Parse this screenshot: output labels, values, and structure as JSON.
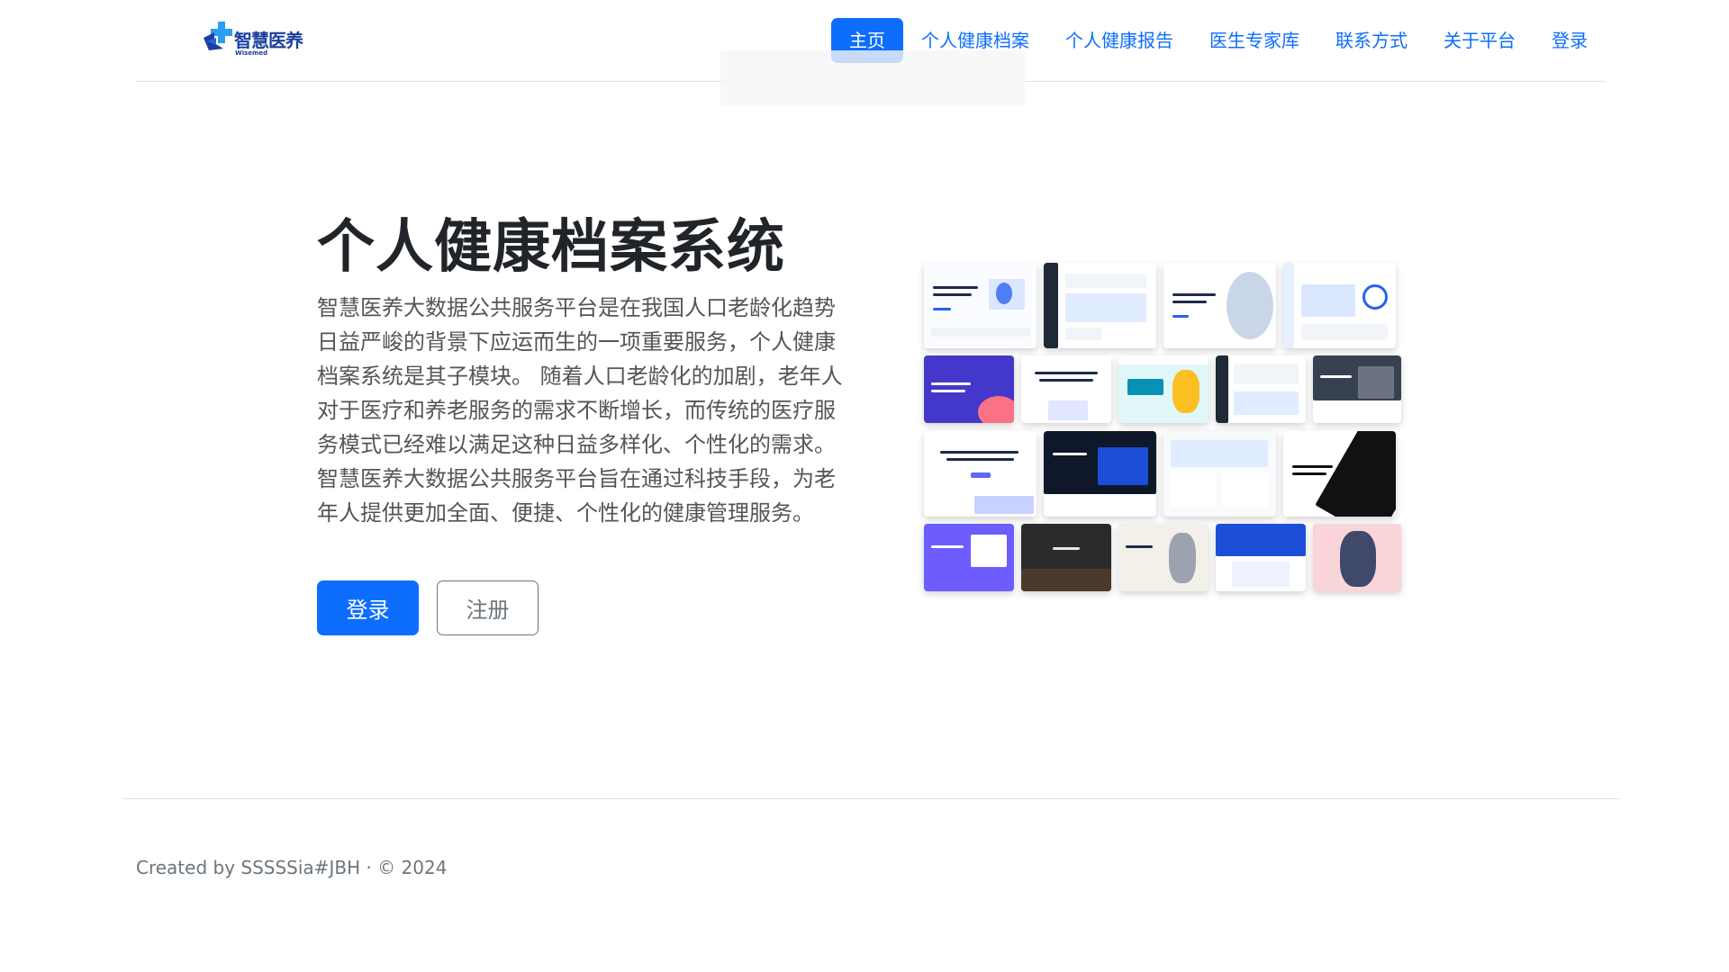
{
  "brand": {
    "name_cn": "智慧医养",
    "name_en": "Wisemed"
  },
  "nav": {
    "items": [
      {
        "label": "主页",
        "active": true
      },
      {
        "label": "个人健康档案",
        "active": false
      },
      {
        "label": "个人健康报告",
        "active": false
      },
      {
        "label": "医生专家库",
        "active": false
      },
      {
        "label": "联系方式",
        "active": false
      },
      {
        "label": "关于平台",
        "active": false
      },
      {
        "label": "登录",
        "active": false
      }
    ]
  },
  "hero": {
    "title": "个人健康档案系统",
    "description": "智慧医养大数据公共服务平台是在我国人口老龄化趋势日益严峻的背景下应运而生的一项重要服务，个人健康档案系统是其子模块。 随着人口老龄化的加剧，老年人对于医疗和养老服务的需求不断增长，而传统的医疗服务模式已经难以满足这种日益多样化、个性化的需求。 智慧医养大数据公共服务平台旨在通过科技手段，为老年人提供更加全面、便捷、个性化的健康管理服务。",
    "login_button": "登录",
    "register_button": "注册"
  },
  "footer": {
    "text": "Created by SSSSSia#JBH · © 2024"
  },
  "colors": {
    "primary": "#0d6efd",
    "brand_blue": "#1a3f9e",
    "text_dark": "#212529",
    "text_muted": "#6c757d"
  }
}
